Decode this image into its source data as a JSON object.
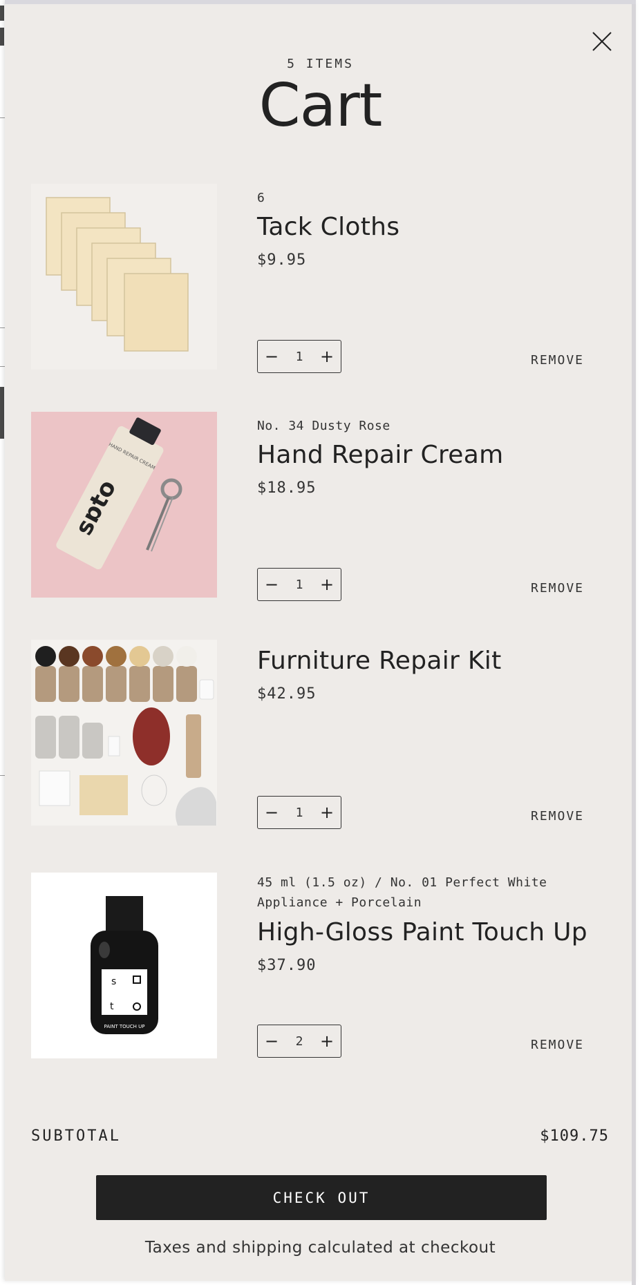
{
  "cart": {
    "count_label": "5 ITEMS",
    "title": "Cart"
  },
  "items": [
    {
      "variant": "6",
      "name": "Tack Cloths",
      "price": "$9.95",
      "quantity": "1",
      "remove_label": "REMOVE",
      "image_icon": "tack-cloths-image"
    },
    {
      "variant": "No. 34 Dusty Rose",
      "name": "Hand Repair Cream",
      "price": "$18.95",
      "quantity": "1",
      "remove_label": "REMOVE",
      "image_icon": "hand-repair-cream-image"
    },
    {
      "variant": "",
      "name": "Furniture Repair Kit",
      "price": "$42.95",
      "quantity": "1",
      "remove_label": "REMOVE",
      "image_icon": "furniture-repair-kit-image"
    },
    {
      "variant": "45 ml (1.5 oz) / No. 01 Perfect White Appliance + Porcelain",
      "name": "High-Gloss Paint Touch Up",
      "price": "$37.90",
      "quantity": "2",
      "remove_label": "REMOVE",
      "image_icon": "paint-touch-up-image"
    }
  ],
  "product_art": {
    "cream_logo": "sɒto",
    "cream_tube_text": "HAND REPAIR CREAM",
    "bottle_label": "PAINT TOUCH UP"
  },
  "summary": {
    "subtotal_label": "SUBTOTAL",
    "subtotal_value": "$109.75",
    "checkout_label": "CHECK OUT",
    "note": "Taxes and shipping calculated at checkout"
  },
  "colors": {
    "drawer_bg": "#eeebe8",
    "checkout_bg": "#222222",
    "pink_bg": "#ecc4c6"
  }
}
